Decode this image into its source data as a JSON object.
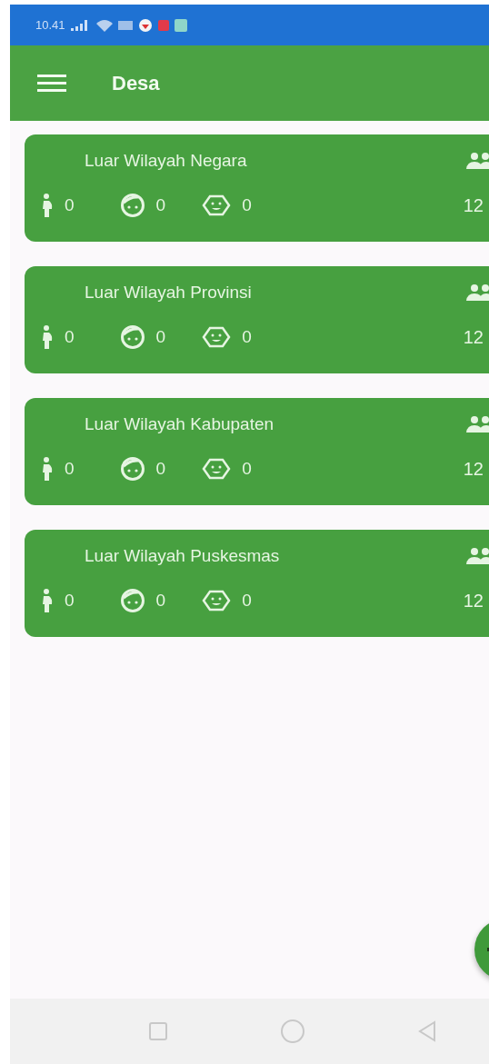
{
  "status_bar": {
    "time": "10.41"
  },
  "app_bar": {
    "title": "Desa"
  },
  "cards": [
    {
      "name": "Luar Wilayah Negara",
      "pregnant": "0",
      "child": "0",
      "baby": "0",
      "total": "12"
    },
    {
      "name": "Luar Wilayah Provinsi",
      "pregnant": "0",
      "child": "0",
      "baby": "0",
      "total": "12"
    },
    {
      "name": "Luar Wilayah Kabupaten",
      "pregnant": "0",
      "child": "0",
      "baby": "0",
      "total": "12"
    },
    {
      "name": "Luar Wilayah Puskesmas",
      "pregnant": "0",
      "child": "0",
      "baby": "0",
      "total": "12"
    }
  ]
}
